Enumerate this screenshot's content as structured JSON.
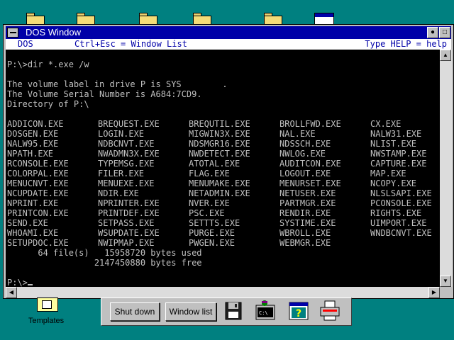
{
  "window": {
    "title": "DOS Window",
    "menubar": {
      "dos_label": "DOS",
      "ctrl_esc_label": "Ctrl+Esc = Window List",
      "help_label": "Type HELP = help"
    }
  },
  "console": {
    "command": "P:\\>dir *.exe /w",
    "volume_label": "The volume label in drive P is SYS        .",
    "serial": "The Volume Serial Number is A684:7CD9.",
    "directory": "Directory of P:\\",
    "files": [
      [
        "ADDICON.EXE",
        "BREQUEST.EXE",
        "BREQUTIL.EXE",
        "BROLLFWD.EXE",
        "CX.EXE"
      ],
      [
        "DOSGEN.EXE",
        "LOGIN.EXE",
        "MIGWIN3X.EXE",
        "NAL.EXE",
        "NALW31.EXE"
      ],
      [
        "NALW95.EXE",
        "NDBCNVT.EXE",
        "NDSMGR16.EXE",
        "NDSSCH.EXE",
        "NLIST.EXE"
      ],
      [
        "NPATH.EXE",
        "NWADMN3X.EXE",
        "NWDETECT.EXE",
        "NWLOG.EXE",
        "NWSTAMP.EXE"
      ],
      [
        "RCONSOLE.EXE",
        "TYPEMSG.EXE",
        "ATOTAL.EXE",
        "AUDITCON.EXE",
        "CAPTURE.EXE"
      ],
      [
        "COLORPAL.EXE",
        "FILER.EXE",
        "FLAG.EXE",
        "LOGOUT.EXE",
        "MAP.EXE"
      ],
      [
        "MENUCNVT.EXE",
        "MENUEXE.EXE",
        "MENUMAKE.EXE",
        "MENURSET.EXE",
        "NCOPY.EXE"
      ],
      [
        "NCUPDATE.EXE",
        "NDIR.EXE",
        "NETADMIN.EXE",
        "NETUSER.EXE",
        "NLSLSAPI.EXE"
      ],
      [
        "NPRINT.EXE",
        "NPRINTER.EXE",
        "NVER.EXE",
        "PARTMGR.EXE",
        "PCONSOLE.EXE"
      ],
      [
        "PRINTCON.EXE",
        "PRINTDEF.EXE",
        "PSC.EXE",
        "RENDIR.EXE",
        "RIGHTS.EXE"
      ],
      [
        "SEND.EXE",
        "SETPASS.EXE",
        "SETTTS.EXE",
        "SYSTIME.EXE",
        "UIMPORT.EXE"
      ],
      [
        "WHOAMI.EXE",
        "WSUPDATE.EXE",
        "PURGE.EXE",
        "WBROLL.EXE",
        "WNDBCNVT.EXE"
      ],
      [
        "SETUPDOC.EXE",
        "NWIPMAP.EXE",
        "PWGEN.EXE",
        "WEBMGR.EXE",
        ""
      ]
    ],
    "summary_used": "      64 file(s)   15958720 bytes used",
    "summary_free": "                 2147450880 bytes free",
    "prompt": "P:\\>"
  },
  "desktop": {
    "templates_label": "Templates"
  },
  "panel": {
    "shutdown_label": "Shut down",
    "windowlist_label": "Window list"
  }
}
